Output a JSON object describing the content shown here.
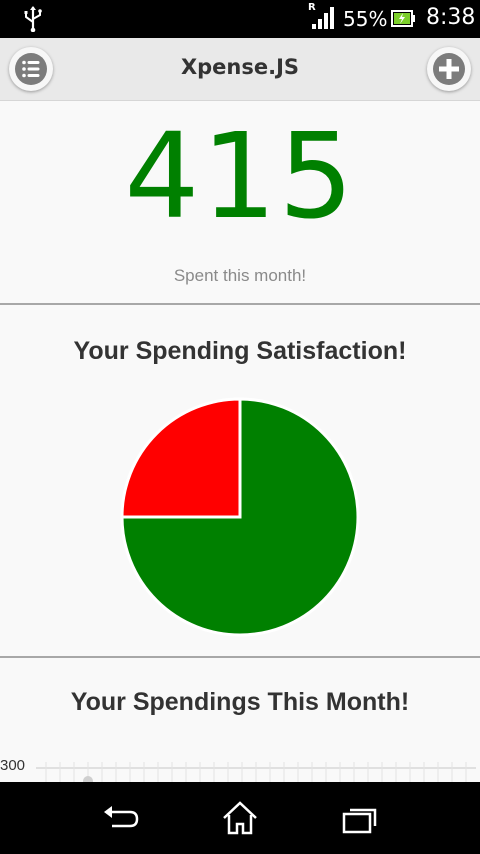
{
  "status_bar": {
    "roaming_indicator": "R",
    "battery_percent": "55%",
    "time": "8:38",
    "icons": [
      "usb-icon",
      "signal-icon",
      "battery-charging-icon"
    ]
  },
  "header": {
    "title": "Xpense.JS",
    "left_icon": "list-menu-icon",
    "right_icon": "add-icon"
  },
  "summary": {
    "amount": "415",
    "caption": "Spent this month!",
    "amount_color": "#008000"
  },
  "satisfaction": {
    "title": "Your Spending Satisfaction!"
  },
  "chart_data": [
    {
      "type": "pie",
      "title": "Your Spending Satisfaction!",
      "slices": [
        {
          "value": 75,
          "color": "#008000"
        },
        {
          "value": 25,
          "color": "#ff0000"
        }
      ]
    },
    {
      "type": "line",
      "title": "Your Spendings This Month!",
      "y_tick_visible": [
        "300"
      ]
    }
  ],
  "monthly": {
    "title": "Your Spendings This Month!",
    "y_tick_top": "300"
  },
  "nav": {
    "icons": [
      "back-icon",
      "home-icon",
      "recent-apps-icon"
    ]
  }
}
